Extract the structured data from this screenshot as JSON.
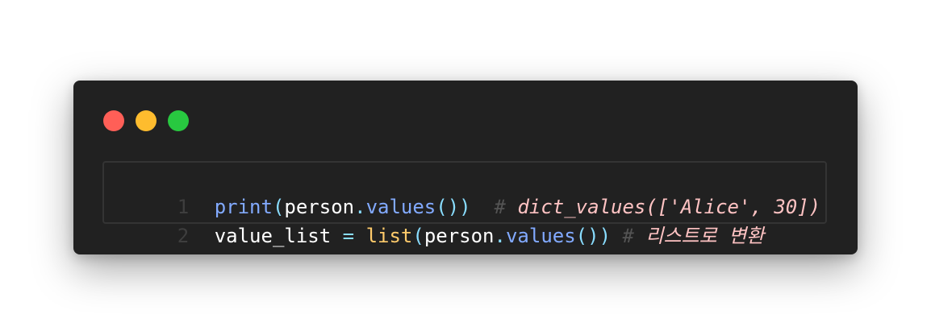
{
  "window": {
    "buttons": [
      {
        "name": "close",
        "color": "#ff5f57"
      },
      {
        "name": "minimize",
        "color": "#febc2e"
      },
      {
        "name": "maximize",
        "color": "#28c840"
      }
    ]
  },
  "code": {
    "lines": [
      {
        "number": "1",
        "tokens": [
          {
            "text": "print",
            "type": "fn"
          },
          {
            "text": "(",
            "type": "paren"
          },
          {
            "text": "person",
            "type": "id"
          },
          {
            "text": ".",
            "type": "dot"
          },
          {
            "text": "values",
            "type": "fn"
          },
          {
            "text": "())",
            "type": "paren"
          },
          {
            "text": "  ",
            "type": "id"
          },
          {
            "text": "# ",
            "type": "cmark"
          },
          {
            "text": "dict_values(['Alice', 30])",
            "type": "comment"
          }
        ]
      },
      {
        "number": "2",
        "tokens": [
          {
            "text": "value_list",
            "type": "id"
          },
          {
            "text": " ",
            "type": "id"
          },
          {
            "text": "=",
            "type": "op"
          },
          {
            "text": " ",
            "type": "id"
          },
          {
            "text": "list",
            "type": "builtin"
          },
          {
            "text": "(",
            "type": "paren"
          },
          {
            "text": "person",
            "type": "id"
          },
          {
            "text": ".",
            "type": "dot"
          },
          {
            "text": "values",
            "type": "fn"
          },
          {
            "text": "())",
            "type": "paren"
          },
          {
            "text": " ",
            "type": "id"
          },
          {
            "text": "# ",
            "type": "cmark"
          },
          {
            "text": "리스트로 변환",
            "type": "comment"
          }
        ]
      }
    ]
  },
  "colors": {
    "background": "#ffffff",
    "editor": "#212121",
    "function": "#82aaff",
    "punctuation": "#89ddff",
    "identifier": "#ffffff",
    "builtin": "#ffcb6b",
    "comment": "#ffc3c3",
    "line_number": "#3e3e3e"
  }
}
